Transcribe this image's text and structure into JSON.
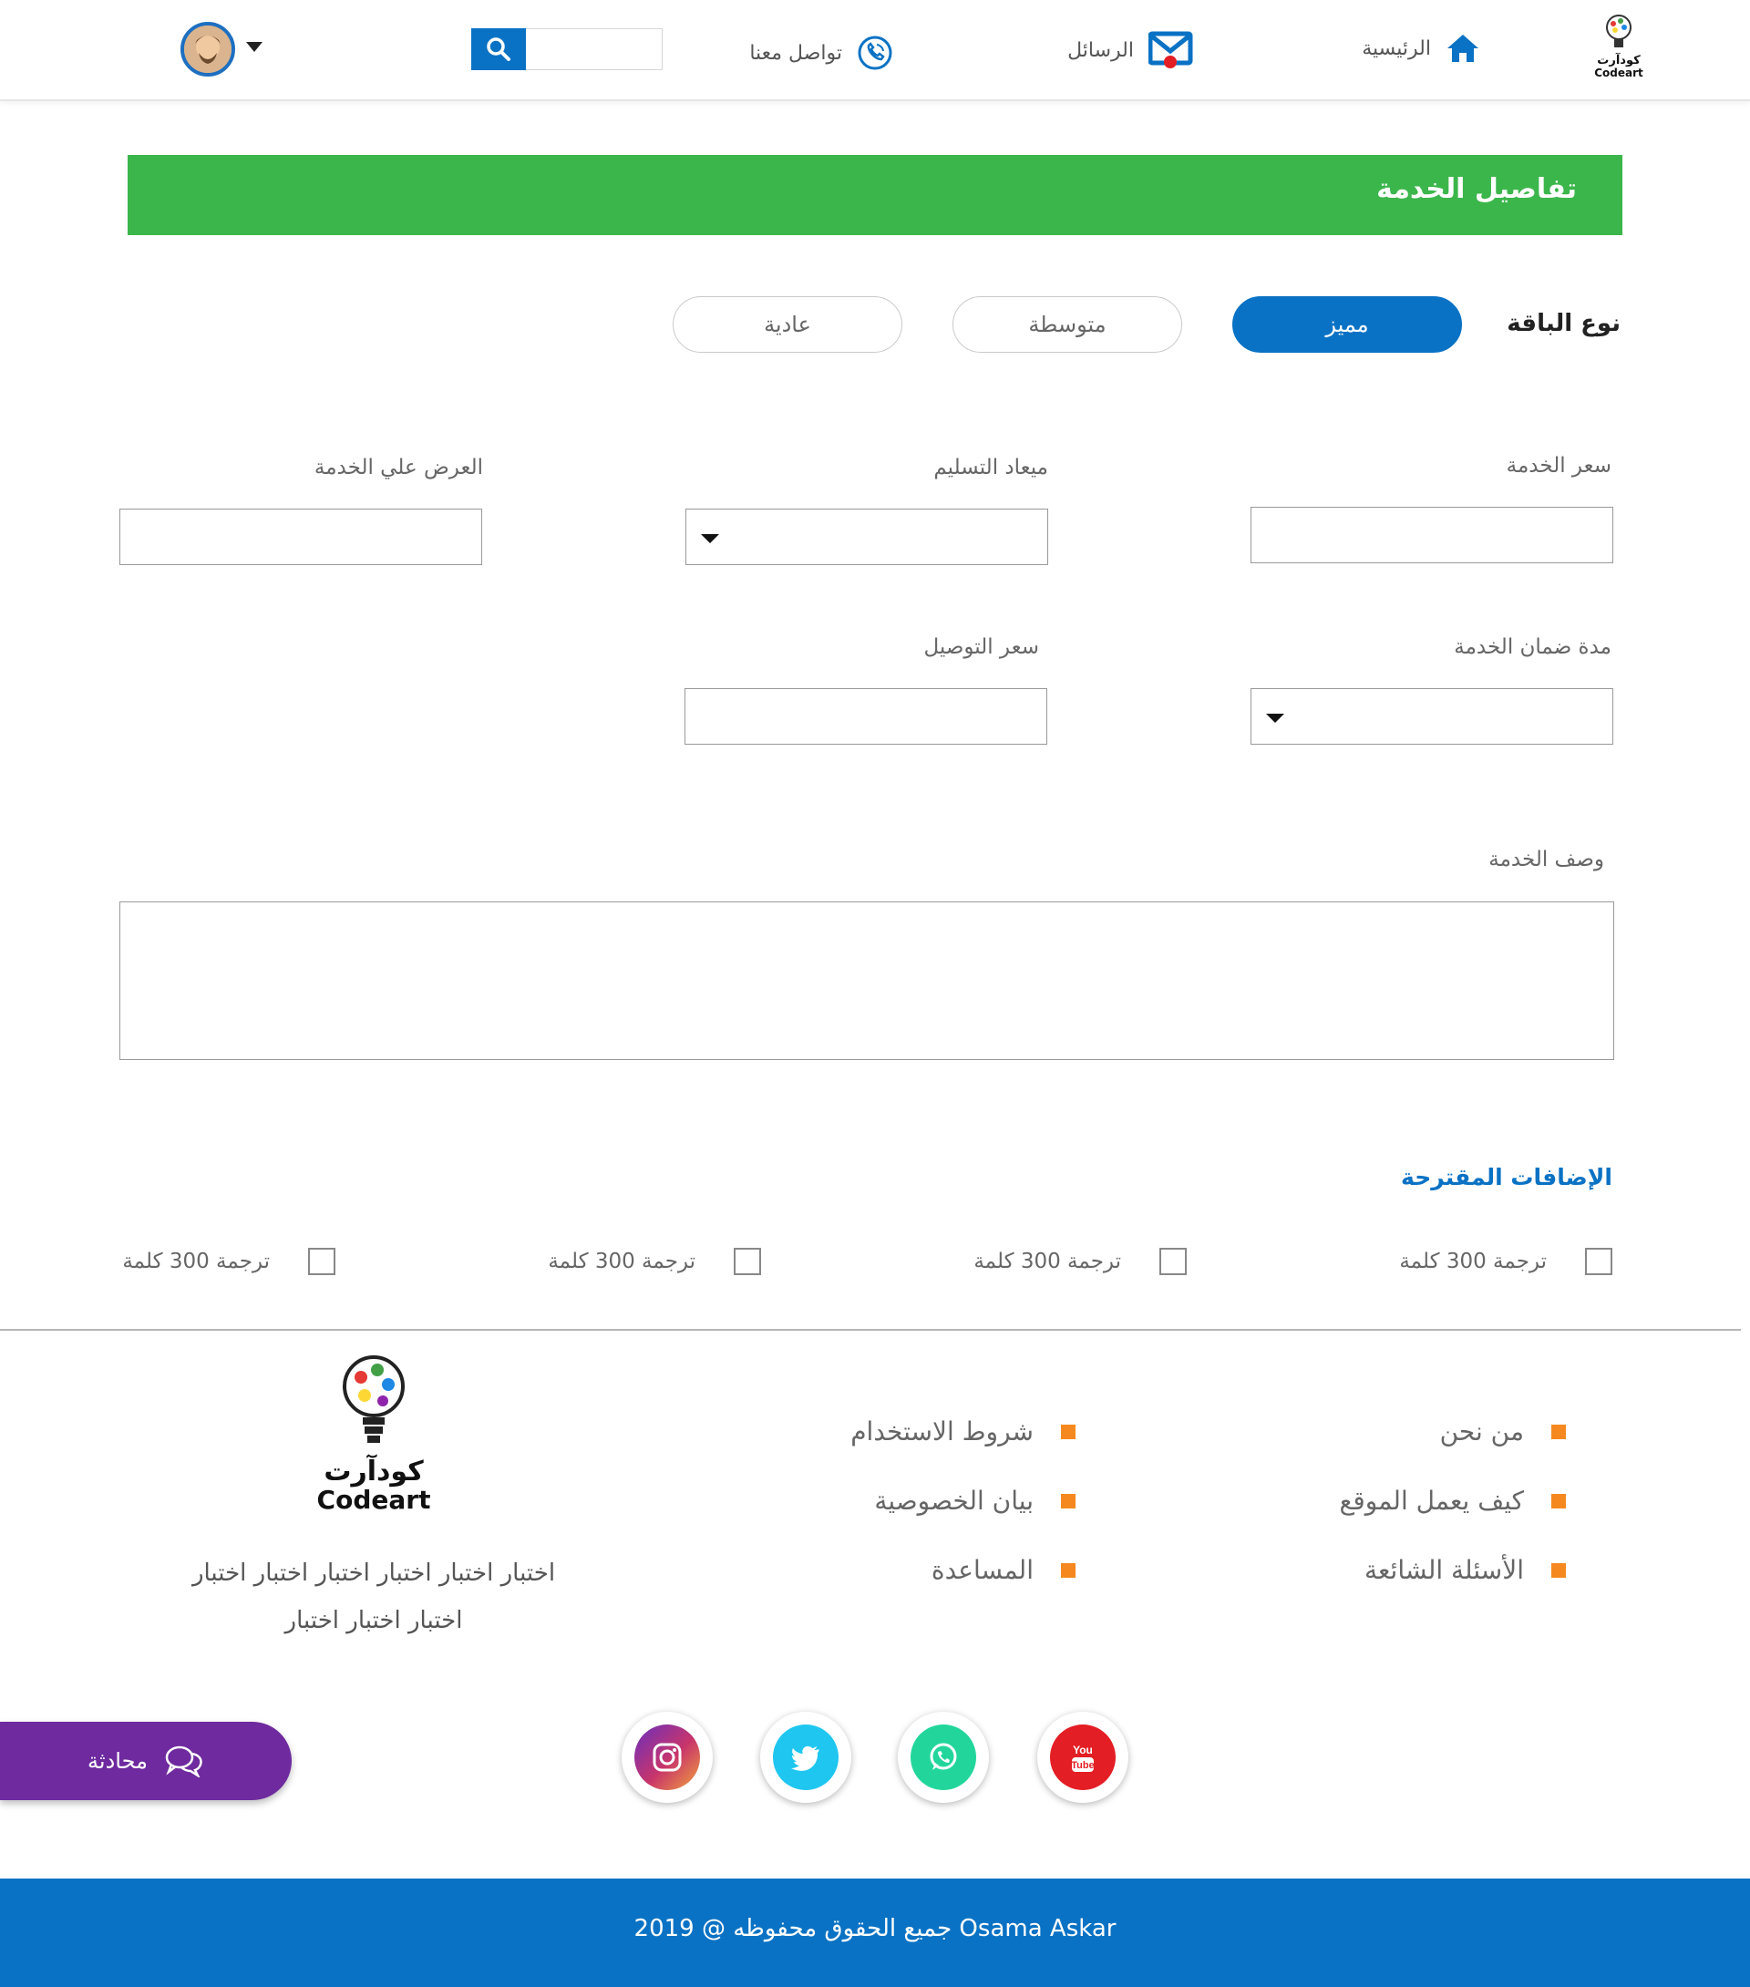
{
  "header": {
    "home_label": "الرئيسية",
    "messages_label": "الرسائل",
    "contact_label": "تواصل معنا",
    "logo_ar": "كودآرت",
    "logo_en": "Codeart"
  },
  "page": {
    "title": "تفاصيل الخدمة",
    "package_label": "نوع الباقة",
    "packages": [
      "مميز",
      "متوسطة",
      "عادية"
    ]
  },
  "form": {
    "service_price_label": "سعر الخدمة",
    "delivery_date_label": "ميعاد التسليم",
    "offer_label": "العرض علي الخدمة",
    "warranty_label": "مدة ضمان الخدمة",
    "delivery_price_label": "سعر التوصيل",
    "description_label": "وصف الخدمة"
  },
  "addons": {
    "title": "الإضافات المقترحة",
    "items": [
      "ترجمة 300 كلمة",
      "ترجمة 300 كلمة",
      "ترجمة 300 كلمة",
      "ترجمة 300 كلمة"
    ]
  },
  "footer": {
    "links_col1": [
      "من نحن",
      "كيف يعمل الموقع",
      "الأسئلة الشائعة"
    ],
    "links_col2": [
      "شروط الاستخدام",
      "بيان الخصوصية",
      "المساعدة"
    ],
    "logo_ar": "كودآرت",
    "logo_en": "Codeart",
    "about_line1": "اختبار اختبار اختبار اختبار اختبار اختبار",
    "about_line2": "اختبار اختبار اختبار",
    "chat_label": "محادثة",
    "copyright": "جميع الحقوق محفوظه @ 2019  Osama Askar",
    "youtube_text": "You Tube"
  },
  "colors": {
    "primary": "#0a72c4",
    "green": "#3bb64b",
    "orange": "#f5891f",
    "purple": "#6e2a9e"
  }
}
